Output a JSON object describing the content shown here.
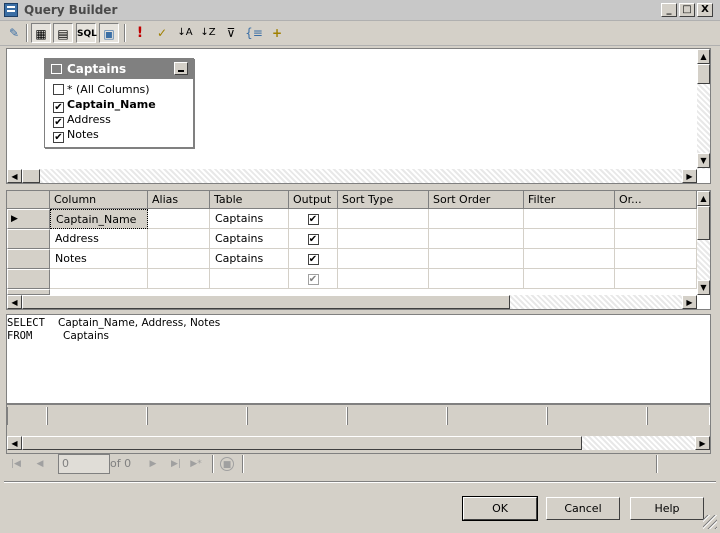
{
  "window": {
    "title": "Query Builder",
    "controls": [
      "_",
      "□",
      "X"
    ]
  },
  "toolbar": {
    "buttons": [
      {
        "name": "diagram-pane",
        "glyph": "▦"
      },
      {
        "name": "grid-pane",
        "glyph": "▤"
      },
      {
        "name": "sql-pane",
        "glyph": "SQL"
      },
      {
        "name": "results-pane",
        "glyph": "▣"
      },
      {
        "name": "run",
        "glyph": "!"
      },
      {
        "name": "verify-sql",
        "glyph": "✓"
      },
      {
        "name": "sort-ascending",
        "glyph": "↓A"
      },
      {
        "name": "sort-descending",
        "glyph": "↓Z"
      },
      {
        "name": "filter",
        "glyph": "⊽"
      },
      {
        "name": "group-by",
        "glyph": "{≡"
      },
      {
        "name": "add-table",
        "glyph": "+"
      }
    ]
  },
  "diagram": {
    "table_name": "Captains",
    "columns": [
      {
        "label": "* (All Columns)",
        "checked": false,
        "bold": false
      },
      {
        "label": "Captain_Name",
        "checked": true,
        "bold": true
      },
      {
        "label": "Address",
        "checked": true,
        "bold": false
      },
      {
        "label": "Notes",
        "checked": true,
        "bold": false
      }
    ]
  },
  "grid": {
    "headers": [
      "Column",
      "Alias",
      "Table",
      "Output",
      "Sort Type",
      "Sort Order",
      "Filter",
      "Or..."
    ],
    "rows": [
      {
        "column": "Captain_Name",
        "alias": "",
        "table": "Captains",
        "output": true,
        "current": true
      },
      {
        "column": "Address",
        "alias": "",
        "table": "Captains",
        "output": true,
        "current": false
      },
      {
        "column": "Notes",
        "alias": "",
        "table": "Captains",
        "output": true,
        "current": false
      },
      {
        "column": "",
        "alias": "",
        "table": "",
        "output": true,
        "current": false
      }
    ]
  },
  "sql": {
    "line1_keyword": "SELECT",
    "line1_text": "Captain_Name, Address, Notes",
    "line2_keyword": "FROM",
    "line2_text": "Captains"
  },
  "nav": {
    "position_value": "0",
    "of_text": "of 0"
  },
  "buttons": {
    "ok": "OK",
    "cancel": "Cancel",
    "help": "Help"
  }
}
